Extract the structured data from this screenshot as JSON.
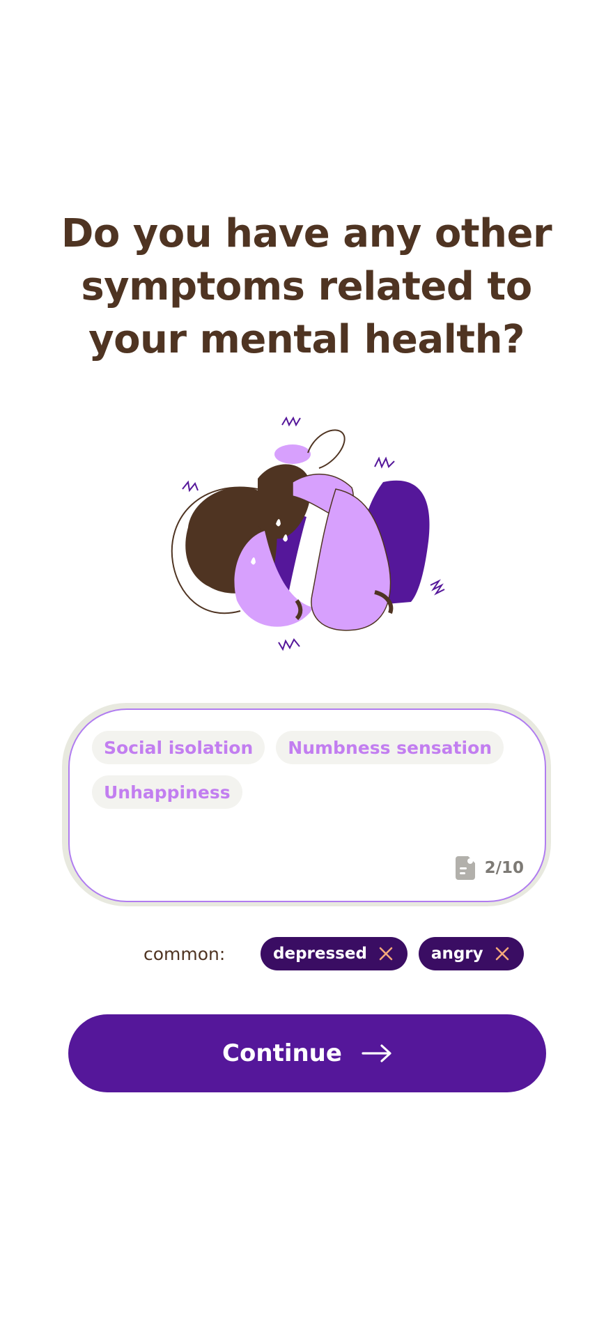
{
  "question": {
    "title": "Do you have any other symptoms related to your mental health?"
  },
  "illustration": {
    "icon": "stressed-person-illustration"
  },
  "symptom_input": {
    "tags": [
      "Social isolation",
      "Numbness sensation",
      "Unhappiness"
    ],
    "counter_text": "2/10",
    "counter_icon": "document-icon"
  },
  "common": {
    "label": "common:",
    "chips": [
      {
        "label": "depressed",
        "remove_icon": "close-icon"
      },
      {
        "label": "angry",
        "remove_icon": "close-icon"
      }
    ]
  },
  "continue_button": {
    "label": "Continue",
    "icon": "arrow-right-icon"
  },
  "colors": {
    "title_brown": "#4f3422",
    "accent_purple": "#55179a",
    "chip_purple": "#3a0d63",
    "tag_text_lilac": "#c27ef0",
    "input_border": "#b07cf0",
    "input_halo": "#e8e9df",
    "chip_close_orange": "#f5a97a"
  }
}
